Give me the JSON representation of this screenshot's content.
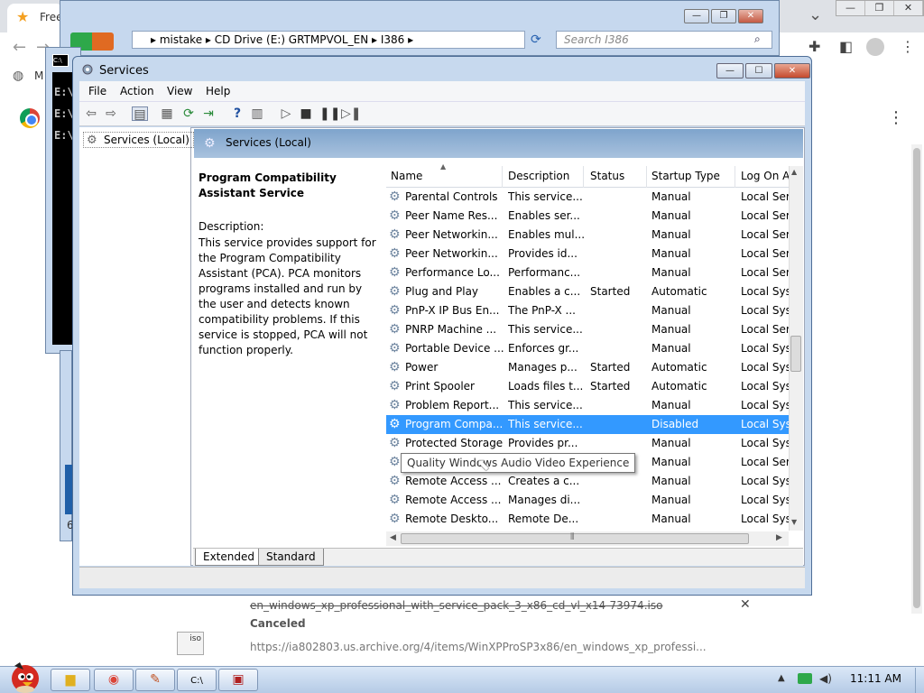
{
  "chrome": {
    "tab_title": "Free",
    "download": {
      "filename": "en_windows_xp_professional_with_service_pack_3_x86_cd_vl_x14-73974.iso",
      "status": "Canceled",
      "url": "https://ia802803.us.archive.org/4/items/WinXPProSP3x86/en_windows_xp_professi...",
      "icon_label": "iso"
    },
    "bookmark_initial": "M"
  },
  "explorer": {
    "address": [
      "mistake",
      "CD Drive (E:) GRTMPVOL_EN",
      "I386"
    ],
    "search_placeholder": "Search I386"
  },
  "cmd": {
    "lines": [
      "E:\\",
      "E:\\",
      "E:\\"
    ]
  },
  "background": {
    "digit": "6"
  },
  "services": {
    "title": "Services",
    "menu": [
      "File",
      "Action",
      "View",
      "Help"
    ],
    "tree_item": "Services (Local)",
    "pane_title": "Services (Local)",
    "selected_service": {
      "name": "Program Compatibility Assistant Service",
      "description_label": "Description:",
      "description": "This service provides support for the Program Compatibility Assistant (PCA).  PCA monitors programs installed and run by the user and detects known compatibility problems. If this service is stopped, PCA will not function properly."
    },
    "columns": [
      "Name",
      "Description",
      "Status",
      "Startup Type",
      "Log On A"
    ],
    "rows": [
      {
        "name": "Parental Controls",
        "desc": "This service...",
        "status": "",
        "startup": "Manual",
        "logon": "Local Ser"
      },
      {
        "name": "Peer Name Res...",
        "desc": "Enables ser...",
        "status": "",
        "startup": "Manual",
        "logon": "Local Ser"
      },
      {
        "name": "Peer Networkin...",
        "desc": "Enables mul...",
        "status": "",
        "startup": "Manual",
        "logon": "Local Ser"
      },
      {
        "name": "Peer Networkin...",
        "desc": "Provides id...",
        "status": "",
        "startup": "Manual",
        "logon": "Local Ser"
      },
      {
        "name": "Performance Lo...",
        "desc": "Performanc...",
        "status": "",
        "startup": "Manual",
        "logon": "Local Ser"
      },
      {
        "name": "Plug and Play",
        "desc": "Enables a c...",
        "status": "Started",
        "startup": "Automatic",
        "logon": "Local Sys"
      },
      {
        "name": "PnP-X IP Bus En...",
        "desc": "The PnP-X ...",
        "status": "",
        "startup": "Manual",
        "logon": "Local Sys"
      },
      {
        "name": "PNRP Machine ...",
        "desc": "This service...",
        "status": "",
        "startup": "Manual",
        "logon": "Local Ser"
      },
      {
        "name": "Portable Device ...",
        "desc": "Enforces gr...",
        "status": "",
        "startup": "Manual",
        "logon": "Local Sys"
      },
      {
        "name": "Power",
        "desc": "Manages p...",
        "status": "Started",
        "startup": "Automatic",
        "logon": "Local Sys"
      },
      {
        "name": "Print Spooler",
        "desc": "Loads files t...",
        "status": "Started",
        "startup": "Automatic",
        "logon": "Local Sys"
      },
      {
        "name": "Problem Report...",
        "desc": "This service...",
        "status": "",
        "startup": "Manual",
        "logon": "Local Sys"
      },
      {
        "name": "Program Compa...",
        "desc": "This service...",
        "status": "",
        "startup": "Disabled",
        "logon": "Local Sys",
        "selected": true
      },
      {
        "name": "Protected Storage",
        "desc": "Provides pr...",
        "status": "",
        "startup": "Manual",
        "logon": "Local Sys"
      },
      {
        "name": "Quality Windows...",
        "desc": "",
        "status": "",
        "startup": "Manual",
        "logon": "Local Ser"
      },
      {
        "name": "Remote Access ...",
        "desc": "Creates a c...",
        "status": "",
        "startup": "Manual",
        "logon": "Local Sys"
      },
      {
        "name": "Remote Access ...",
        "desc": "Manages di...",
        "status": "",
        "startup": "Manual",
        "logon": "Local Sys"
      },
      {
        "name": "Remote Deskto...",
        "desc": "Remote De...",
        "status": "",
        "startup": "Manual",
        "logon": "Local Sys"
      }
    ],
    "tooltip": "Quality Windows Audio Video Experience",
    "tabs": [
      "Extended",
      "Standard"
    ]
  },
  "taskbar": {
    "clock": "11:11 AM"
  },
  "colors": {
    "selection": "#3399ff",
    "window_frame": "#c7d9ee",
    "pane_header": "#7ea4cc"
  }
}
